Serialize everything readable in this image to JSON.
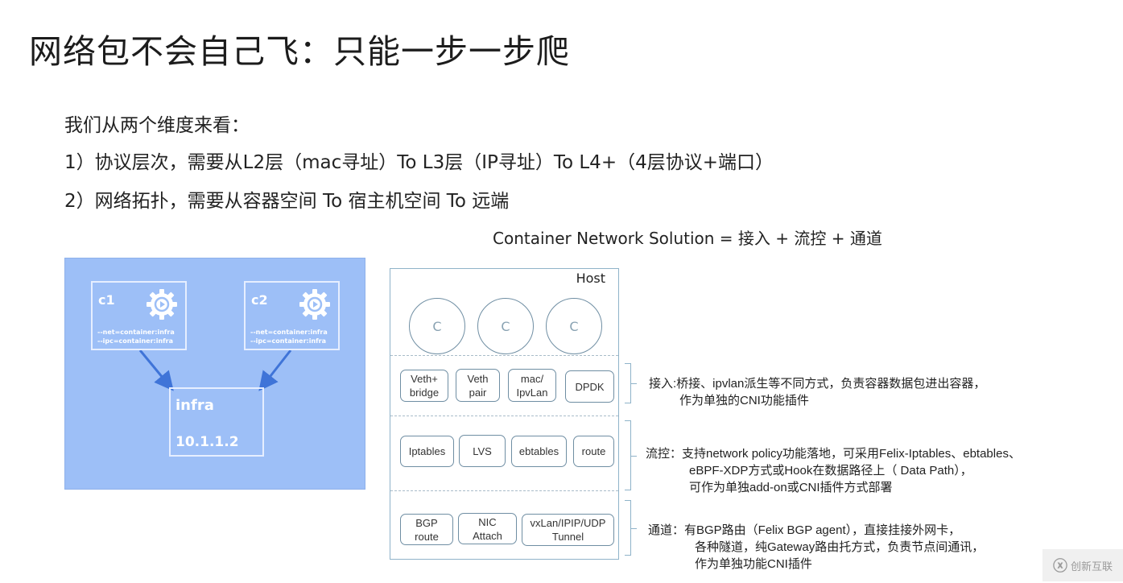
{
  "title": "网络包不会自己飞：只能一步一步爬",
  "intro": "我们从两个维度来看：",
  "points": [
    "1）协议层次，需要从L2层（mac寻址）To  L3层（IP寻址）To  L4+（4层协议+端口）",
    "2）网络拓扑，需要从容器空间  To  宿主机空间  To 远端"
  ],
  "formula": "Container Network Solution = 接入 + 流控 + 通道",
  "pod_diagram": {
    "containers": [
      {
        "name": "c1",
        "flags": [
          "--net=container:infra",
          "--ipc=container:infra"
        ],
        "icon": "gear-play-icon"
      },
      {
        "name": "c2",
        "flags": [
          "--net=container:infra",
          "--ipc=container:infra"
        ],
        "icon": "gear-play-icon"
      }
    ],
    "infra": {
      "name": "infra",
      "ip": "10.1.1.2"
    },
    "colors": {
      "background": "#9dbff7",
      "arrow": "#3f74d8",
      "border": "#e6eeff"
    }
  },
  "host_diagram": {
    "label": "Host",
    "containers": [
      "C",
      "C",
      "C"
    ],
    "access_components": [
      "Veth+\nbridge",
      "Veth\npair",
      "mac/\nIpvLan",
      "DPDK"
    ],
    "flow_components": [
      "Iptables",
      "LVS",
      "ebtables",
      "route"
    ],
    "channel_components": [
      "BGP\nroute",
      "NIC\nAttach",
      "vxLan/IPIP/UDP\nTunnel"
    ]
  },
  "descriptions": {
    "access": [
      "接入:桥接、ipvlan派生等不同方式，负责容器数据包进出容器，",
      "作为单独的CNI功能插件"
    ],
    "flow": [
      "流控：支持network policy功能落地，可采用Felix-Iptables、ebtables、",
      "eBPF-XDP方式或Hook在数据路径上（ Data Path），",
      "可作为单独add-on或CNI插件方式部署"
    ],
    "channel": [
      "通道：有BGP路由（Felix BGP agent），直接挂接外网卡，",
      "各种隧道，纯Gateway路由托方式，负责节点间通讯，",
      "作为单独功能CNI插件"
    ]
  },
  "watermark": {
    "icon": "logo-icon",
    "text": "创新互联"
  }
}
